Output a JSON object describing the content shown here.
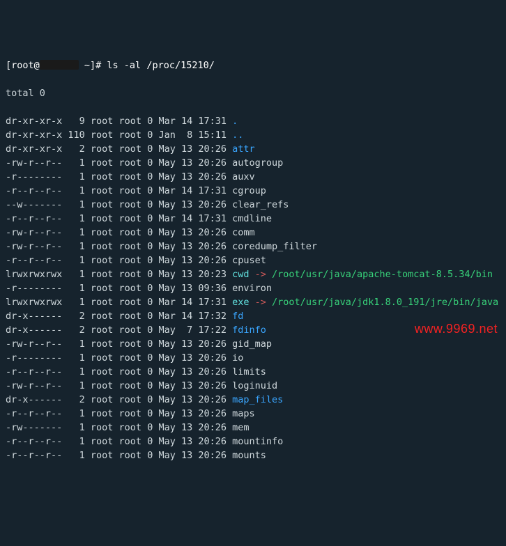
{
  "prompt": {
    "user_host_left": "[root@",
    "user_host_right": " ~]# ",
    "command": "ls -al /proc/15210/"
  },
  "total_line": "total 0",
  "rows": [
    {
      "perm": "dr-xr-xr-x",
      "links": "9",
      "own": "root",
      "grp": "root",
      "size": "0",
      "date": "Mar 14 17:31",
      "name": ".",
      "cls": "dir"
    },
    {
      "perm": "dr-xr-xr-x",
      "links": "110",
      "own": "root",
      "grp": "root",
      "size": "0",
      "date": "Jan  8 15:11",
      "name": "..",
      "cls": "dir"
    },
    {
      "perm": "dr-xr-xr-x",
      "links": "2",
      "own": "root",
      "grp": "root",
      "size": "0",
      "date": "May 13 20:26",
      "name": "attr",
      "cls": "dir"
    },
    {
      "perm": "-rw-r--r--",
      "links": "1",
      "own": "root",
      "grp": "root",
      "size": "0",
      "date": "May 13 20:26",
      "name": "autogroup",
      "cls": ""
    },
    {
      "perm": "-r--------",
      "links": "1",
      "own": "root",
      "grp": "root",
      "size": "0",
      "date": "May 13 20:26",
      "name": "auxv",
      "cls": ""
    },
    {
      "perm": "-r--r--r--",
      "links": "1",
      "own": "root",
      "grp": "root",
      "size": "0",
      "date": "Mar 14 17:31",
      "name": "cgroup",
      "cls": ""
    },
    {
      "perm": "--w-------",
      "links": "1",
      "own": "root",
      "grp": "root",
      "size": "0",
      "date": "May 13 20:26",
      "name": "clear_refs",
      "cls": ""
    },
    {
      "perm": "-r--r--r--",
      "links": "1",
      "own": "root",
      "grp": "root",
      "size": "0",
      "date": "Mar 14 17:31",
      "name": "cmdline",
      "cls": ""
    },
    {
      "perm": "-rw-r--r--",
      "links": "1",
      "own": "root",
      "grp": "root",
      "size": "0",
      "date": "May 13 20:26",
      "name": "comm",
      "cls": ""
    },
    {
      "perm": "-rw-r--r--",
      "links": "1",
      "own": "root",
      "grp": "root",
      "size": "0",
      "date": "May 13 20:26",
      "name": "coredump_filter",
      "cls": ""
    },
    {
      "perm": "-r--r--r--",
      "links": "1",
      "own": "root",
      "grp": "root",
      "size": "0",
      "date": "May 13 20:26",
      "name": "cpuset",
      "cls": ""
    },
    {
      "perm": "lrwxrwxrwx",
      "links": "1",
      "own": "root",
      "grp": "root",
      "size": "0",
      "date": "May 13 20:23",
      "name": "cwd",
      "cls": "link",
      "arrow": "->",
      "target": "/root/usr/java/apache-tomcat-8.5.34/bin"
    },
    {
      "perm": "-r--------",
      "links": "1",
      "own": "root",
      "grp": "root",
      "size": "0",
      "date": "May 13 09:36",
      "name": "environ",
      "cls": ""
    },
    {
      "perm": "lrwxrwxrwx",
      "links": "1",
      "own": "root",
      "grp": "root",
      "size": "0",
      "date": "Mar 14 17:31",
      "name": "exe",
      "cls": "link",
      "arrow": "->",
      "target": "/root/usr/java/jdk1.8.0_191/jre/bin/java"
    },
    {
      "perm": "dr-x------",
      "links": "2",
      "own": "root",
      "grp": "root",
      "size": "0",
      "date": "Mar 14 17:32",
      "name": "fd",
      "cls": "dir"
    },
    {
      "perm": "dr-x------",
      "links": "2",
      "own": "root",
      "grp": "root",
      "size": "0",
      "date": "May  7 17:22",
      "name": "fdinfo",
      "cls": "dir"
    },
    {
      "perm": "-rw-r--r--",
      "links": "1",
      "own": "root",
      "grp": "root",
      "size": "0",
      "date": "May 13 20:26",
      "name": "gid_map",
      "cls": ""
    },
    {
      "perm": "-r--------",
      "links": "1",
      "own": "root",
      "grp": "root",
      "size": "0",
      "date": "May 13 20:26",
      "name": "io",
      "cls": ""
    },
    {
      "perm": "-r--r--r--",
      "links": "1",
      "own": "root",
      "grp": "root",
      "size": "0",
      "date": "May 13 20:26",
      "name": "limits",
      "cls": ""
    },
    {
      "perm": "-rw-r--r--",
      "links": "1",
      "own": "root",
      "grp": "root",
      "size": "0",
      "date": "May 13 20:26",
      "name": "loginuid",
      "cls": ""
    },
    {
      "perm": "dr-x------",
      "links": "2",
      "own": "root",
      "grp": "root",
      "size": "0",
      "date": "May 13 20:26",
      "name": "map_files",
      "cls": "dir"
    },
    {
      "perm": "-r--r--r--",
      "links": "1",
      "own": "root",
      "grp": "root",
      "size": "0",
      "date": "May 13 20:26",
      "name": "maps",
      "cls": ""
    },
    {
      "perm": "-rw-------",
      "links": "1",
      "own": "root",
      "grp": "root",
      "size": "0",
      "date": "May 13 20:26",
      "name": "mem",
      "cls": ""
    },
    {
      "perm": "-r--r--r--",
      "links": "1",
      "own": "root",
      "grp": "root",
      "size": "0",
      "date": "May 13 20:26",
      "name": "mountinfo",
      "cls": ""
    },
    {
      "perm": "-r--r--r--",
      "links": "1",
      "own": "root",
      "grp": "root",
      "size": "0",
      "date": "May 13 20:26",
      "name": "mounts",
      "cls": ""
    }
  ],
  "watermark": "www.9969.net"
}
